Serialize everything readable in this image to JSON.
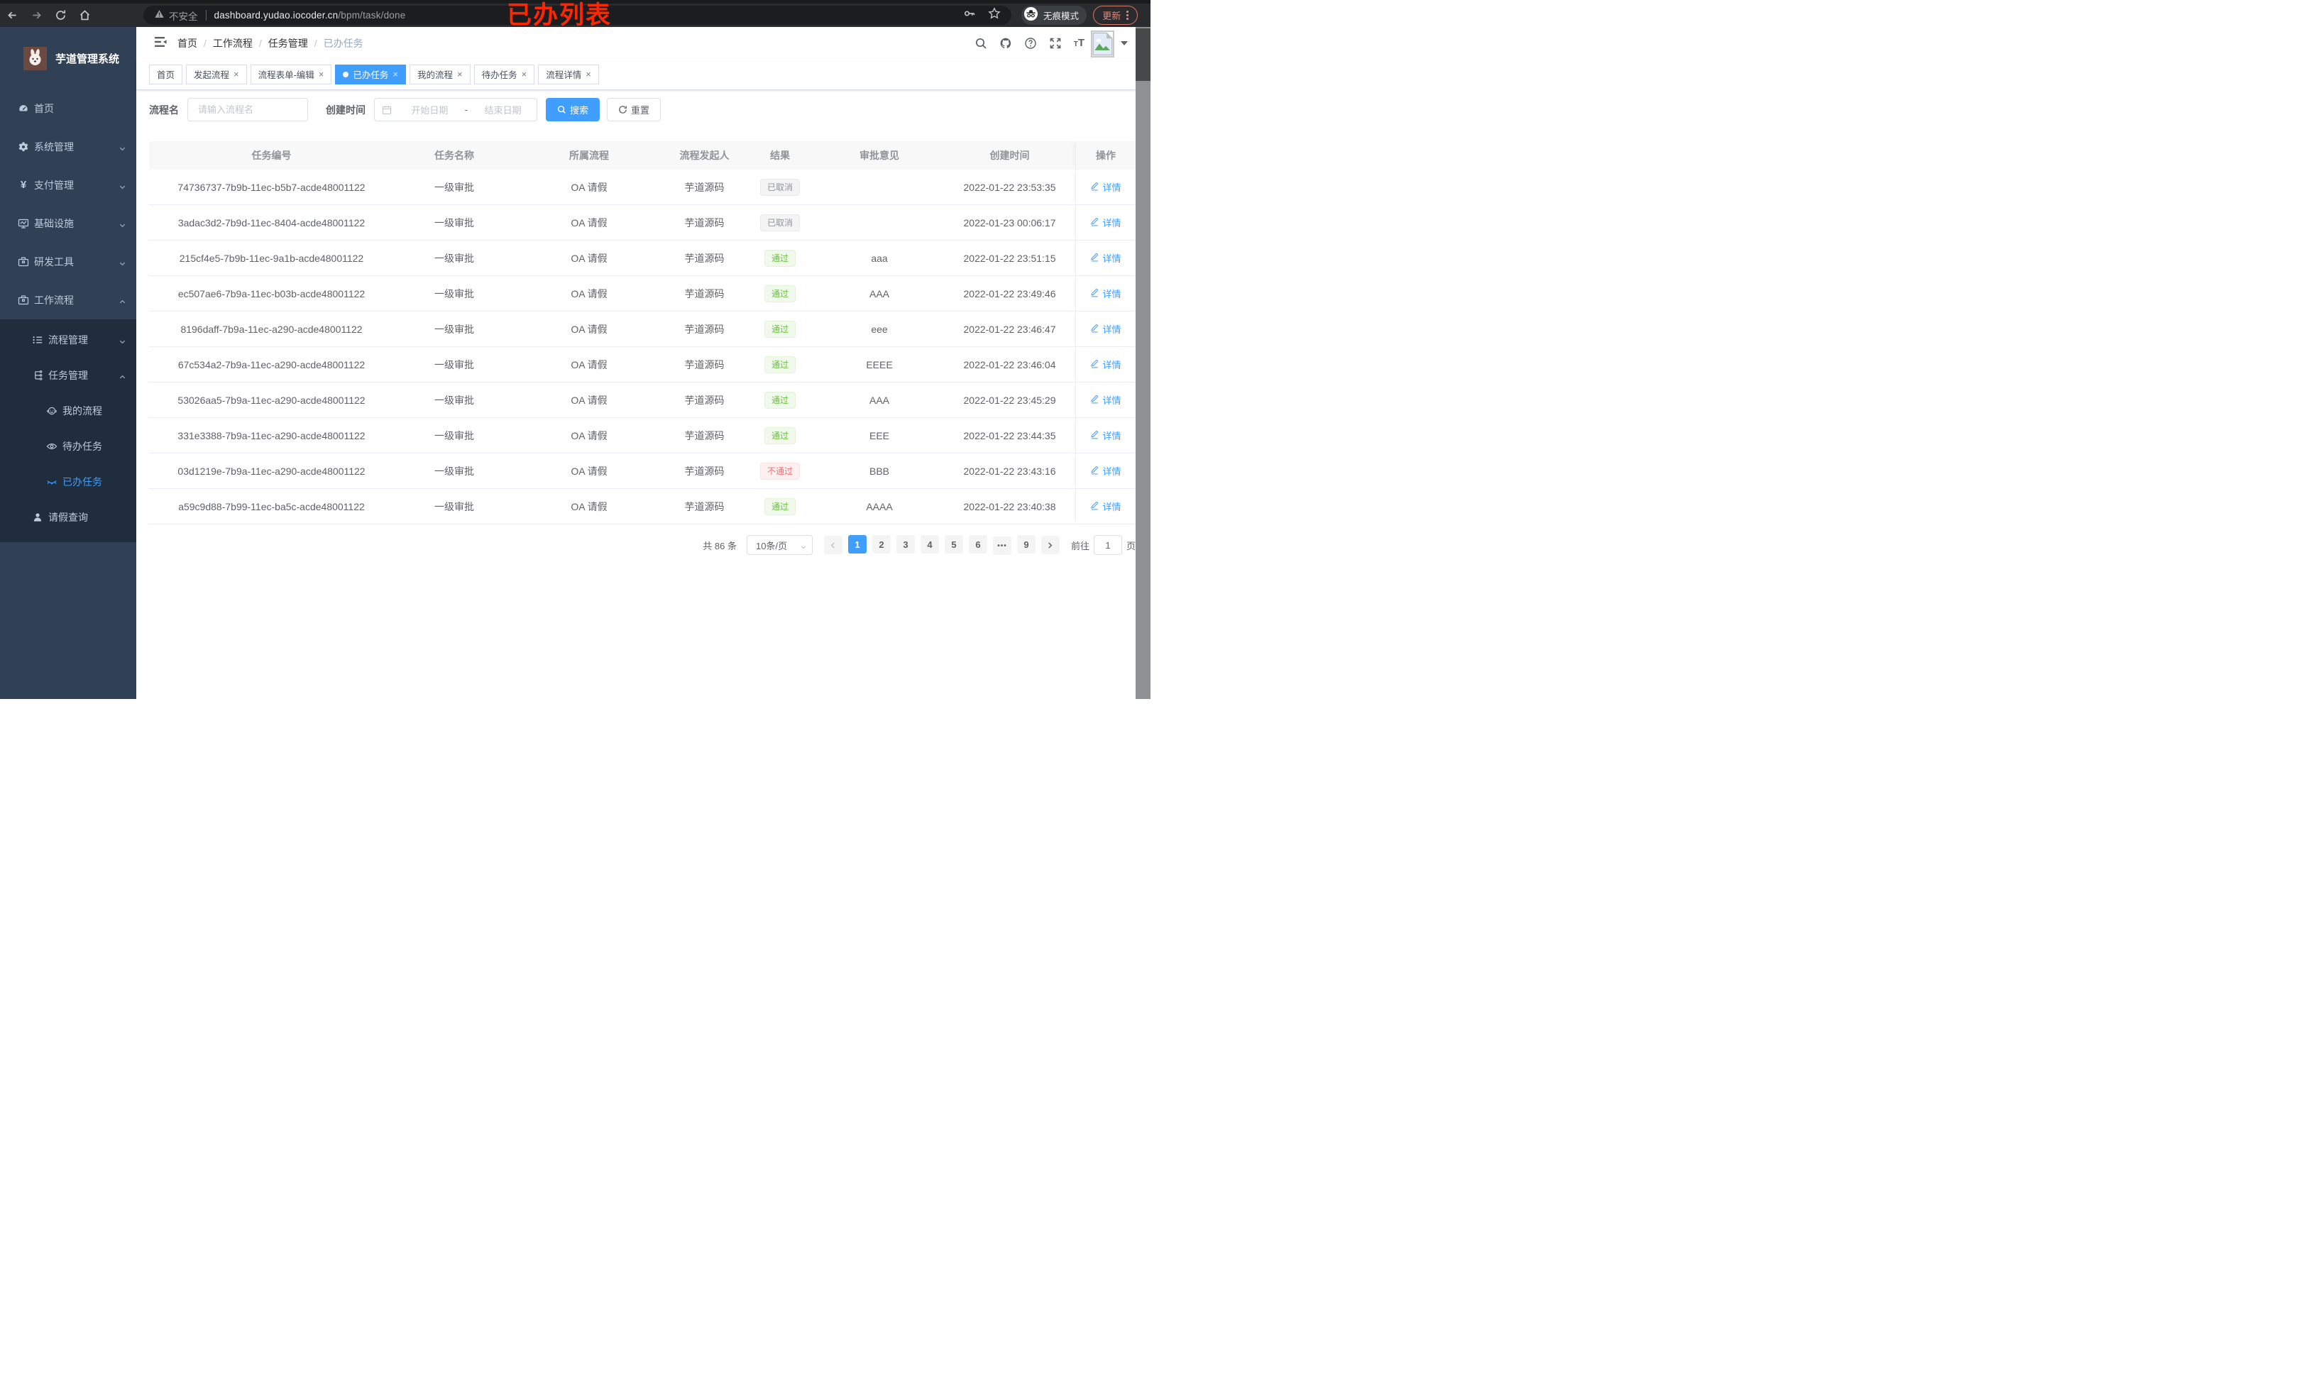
{
  "browser": {
    "security_label": "不安全",
    "url_host": "dashboard.yudao.iocoder.cn",
    "url_path": "/bpm/task/done",
    "incognito_label": "无痕模式",
    "update_label": "更新"
  },
  "annotation": {
    "text": "已办列表",
    "color": "#ff2600"
  },
  "app": {
    "title": "芋道管理系统"
  },
  "sidebar": {
    "items": [
      {
        "name": "home",
        "label": "首页",
        "icon": "gauge-icon",
        "chevron": ""
      },
      {
        "name": "system-management",
        "label": "系统管理",
        "icon": "gear-icon",
        "chevron": "down"
      },
      {
        "name": "payment-management",
        "label": "支付管理",
        "icon": "yen-icon",
        "chevron": "down"
      },
      {
        "name": "infrastructure",
        "label": "基础设施",
        "icon": "monitor-icon",
        "chevron": "down"
      },
      {
        "name": "dev-tools",
        "label": "研发工具",
        "icon": "toolbox-icon",
        "chevron": "down"
      },
      {
        "name": "workflow",
        "label": "工作流程",
        "icon": "toolbox-icon",
        "chevron": "up"
      }
    ],
    "submenu": [
      {
        "name": "process-management",
        "label": "流程管理",
        "icon": "list-icon",
        "level": 2,
        "chevron": "down",
        "active": false
      },
      {
        "name": "task-management",
        "label": "任务管理",
        "icon": "tree-icon",
        "level": 2,
        "chevron": "up",
        "active": false
      },
      {
        "name": "my-process",
        "label": "我的流程",
        "icon": "face-icon",
        "level": 3,
        "chevron": "",
        "active": false
      },
      {
        "name": "todo-task",
        "label": "待办任务",
        "icon": "eye-icon",
        "level": 3,
        "chevron": "",
        "active": false
      },
      {
        "name": "done-task",
        "label": "已办任务",
        "icon": "eye-closed-icon",
        "level": 3,
        "chevron": "",
        "active": true
      },
      {
        "name": "leave-query",
        "label": "请假查询",
        "icon": "user-icon",
        "level": 2,
        "chevron": "",
        "active": false
      }
    ]
  },
  "breadcrumb": {
    "items": [
      "首页",
      "工作流程",
      "任务管理",
      "已办任务"
    ]
  },
  "tabs": [
    {
      "label": "首页",
      "closable": false,
      "active": false
    },
    {
      "label": "发起流程",
      "closable": true,
      "active": false
    },
    {
      "label": "流程表单-编辑",
      "closable": true,
      "active": false
    },
    {
      "label": "已办任务",
      "closable": true,
      "active": true
    },
    {
      "label": "我的流程",
      "closable": true,
      "active": false
    },
    {
      "label": "待办任务",
      "closable": true,
      "active": false
    },
    {
      "label": "流程详情",
      "closable": true,
      "active": false
    }
  ],
  "filters": {
    "name_label": "流程名",
    "name_placeholder": "请输入流程名",
    "time_label": "创建时间",
    "start_placeholder": "开始日期",
    "range_separator": "-",
    "end_placeholder": "结束日期",
    "search_label": "搜索",
    "reset_label": "重置"
  },
  "table": {
    "columns": [
      "任务编号",
      "任务名称",
      "所属流程",
      "流程发起人",
      "结果",
      "审批意见",
      "创建时间",
      "操作"
    ],
    "detail_label": "详情",
    "rows": [
      {
        "id": "74736737-7b9b-11ec-b5b7-acde48001122",
        "name": "一级审批",
        "process": "OA 请假",
        "starter": "芋道源码",
        "result": "已取消",
        "result_type": "info",
        "comment": "",
        "time": "2022-01-22 23:53:35"
      },
      {
        "id": "3adac3d2-7b9d-11ec-8404-acde48001122",
        "name": "一级审批",
        "process": "OA 请假",
        "starter": "芋道源码",
        "result": "已取消",
        "result_type": "info",
        "comment": "",
        "time": "2022-01-23 00:06:17"
      },
      {
        "id": "215cf4e5-7b9b-11ec-9a1b-acde48001122",
        "name": "一级审批",
        "process": "OA 请假",
        "starter": "芋道源码",
        "result": "通过",
        "result_type": "success",
        "comment": "aaa",
        "time": "2022-01-22 23:51:15"
      },
      {
        "id": "ec507ae6-7b9a-11ec-b03b-acde48001122",
        "name": "一级审批",
        "process": "OA 请假",
        "starter": "芋道源码",
        "result": "通过",
        "result_type": "success",
        "comment": "AAA",
        "time": "2022-01-22 23:49:46"
      },
      {
        "id": "8196daff-7b9a-11ec-a290-acde48001122",
        "name": "一级审批",
        "process": "OA 请假",
        "starter": "芋道源码",
        "result": "通过",
        "result_type": "success",
        "comment": "eee",
        "time": "2022-01-22 23:46:47"
      },
      {
        "id": "67c534a2-7b9a-11ec-a290-acde48001122",
        "name": "一级审批",
        "process": "OA 请假",
        "starter": "芋道源码",
        "result": "通过",
        "result_type": "success",
        "comment": "EEEE",
        "time": "2022-01-22 23:46:04"
      },
      {
        "id": "53026aa5-7b9a-11ec-a290-acde48001122",
        "name": "一级审批",
        "process": "OA 请假",
        "starter": "芋道源码",
        "result": "通过",
        "result_type": "success",
        "comment": "AAA",
        "time": "2022-01-22 23:45:29"
      },
      {
        "id": "331e3388-7b9a-11ec-a290-acde48001122",
        "name": "一级审批",
        "process": "OA 请假",
        "starter": "芋道源码",
        "result": "通过",
        "result_type": "success",
        "comment": "EEE",
        "time": "2022-01-22 23:44:35"
      },
      {
        "id": "03d1219e-7b9a-11ec-a290-acde48001122",
        "name": "一级审批",
        "process": "OA 请假",
        "starter": "芋道源码",
        "result": "不通过",
        "result_type": "danger",
        "comment": "BBB",
        "time": "2022-01-22 23:43:16"
      },
      {
        "id": "a59c9d88-7b99-11ec-ba5c-acde48001122",
        "name": "一级审批",
        "process": "OA 请假",
        "starter": "芋道源码",
        "result": "通过",
        "result_type": "success",
        "comment": "AAAA",
        "time": "2022-01-22 23:40:38"
      }
    ]
  },
  "pagination": {
    "total_label": "共 86 条",
    "page_size": "10条/页",
    "pages": [
      "1",
      "2",
      "3",
      "4",
      "5",
      "6",
      "•••",
      "9"
    ],
    "active_page": "1",
    "goto_label": "前往",
    "goto_value": "1",
    "page_unit": "页"
  },
  "colors": {
    "accent": "#409eff",
    "success": "#67c23a",
    "danger": "#f56c6c",
    "info": "#909399",
    "sidebar_bg": "#304156",
    "submenu_bg": "#1f2d3d"
  }
}
